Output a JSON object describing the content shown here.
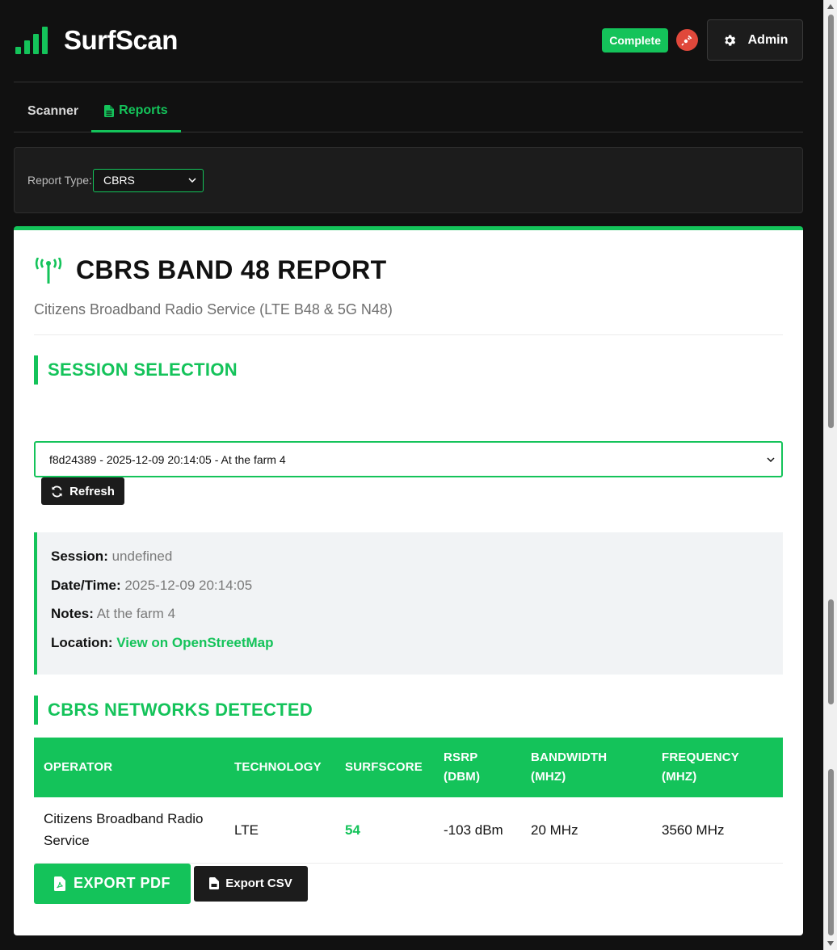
{
  "app": {
    "name": "SurfScan",
    "status_badge": "Complete",
    "admin_label": "Admin"
  },
  "tabs": [
    {
      "label": "Scanner",
      "active": false
    },
    {
      "label": "Reports",
      "active": true,
      "icon": "file-icon"
    }
  ],
  "filter": {
    "label": "Report Type:",
    "selected": "CBRS"
  },
  "report": {
    "title": "CBRS BAND 48 REPORT",
    "subtitle": "Citizens Broadband Radio Service (LTE B48 & 5G N48)",
    "session_section_title": "SESSION SELECTION",
    "session_selected": "f8d24389 - 2025-12-09 20:14:05 - At the farm 4",
    "refresh_label": "Refresh",
    "session_info": {
      "session_label": "Session:",
      "session_value": "undefined",
      "datetime_label": "Date/Time:",
      "datetime_value": "2025-12-09 20:14:05",
      "notes_label": "Notes:",
      "notes_value": "At the farm 4",
      "location_label": "Location:",
      "location_link": "View on OpenStreetMap"
    },
    "networks_section_title": "CBRS NETWORKS DETECTED",
    "table": {
      "headers": [
        "OPERATOR",
        "TECHNOLOGY",
        "SURFSCORE",
        "RSRP (DBM)",
        "BANDWIDTH (MHZ)",
        "FREQUENCY (MHZ)"
      ],
      "rows": [
        [
          "Citizens Broadband Radio Service",
          "LTE",
          "54",
          "-103 dBm",
          "20 MHz",
          "3560 MHz"
        ]
      ]
    },
    "export_pdf_label": "EXPORT PDF",
    "export_csv_label": "Export CSV"
  },
  "colors": {
    "accent": "#14c35a",
    "background": "#111111",
    "status_dot": "#e0483b"
  }
}
